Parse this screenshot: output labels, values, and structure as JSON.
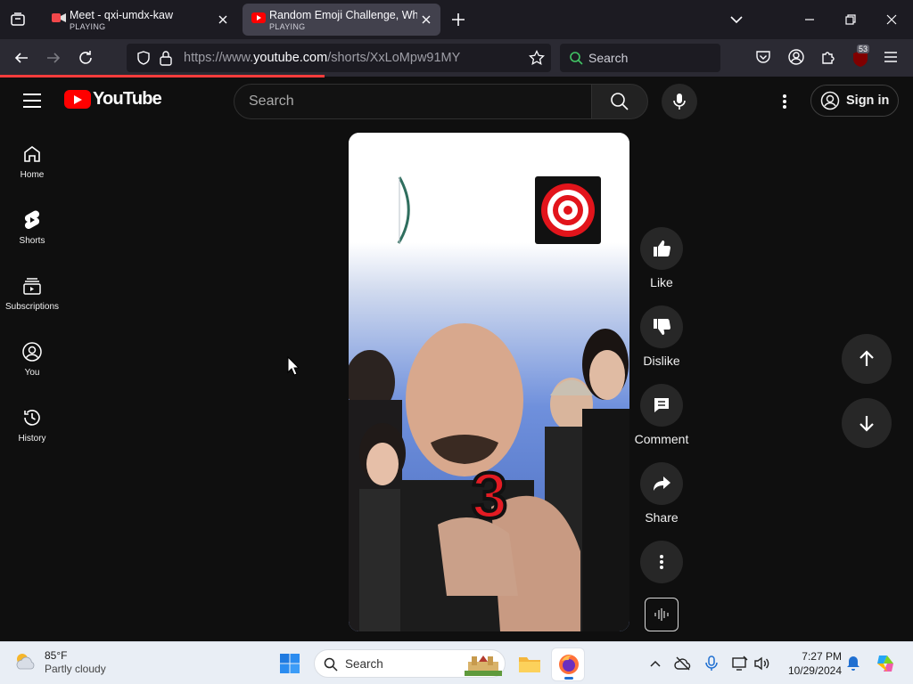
{
  "browser": {
    "tabs": [
      {
        "title": "Meet - qxi-umdx-kaw",
        "status": "PLAYING"
      },
      {
        "title": "Random Emoji Challenge, Who",
        "status": "PLAYING"
      }
    ],
    "url_prefix": "https://www.",
    "url_host": "youtube.com",
    "url_path": "/shorts/XxLoMpw91MY",
    "search_placeholder": "Search",
    "extension_badge": "53",
    "accent_color": "#ff3c3c"
  },
  "youtube": {
    "logo_text": "YouTube",
    "search_placeholder": "Search",
    "sign_in_label": "Sign in",
    "sidebar": [
      {
        "label": "Home"
      },
      {
        "label": "Shorts"
      },
      {
        "label": "Subscriptions"
      },
      {
        "label": "You"
      },
      {
        "label": "History"
      }
    ],
    "actions": {
      "like": "Like",
      "dislike": "Dislike",
      "comment": "Comment",
      "share": "Share"
    },
    "video_overlay_number": "3",
    "brand_color": "#ff0000"
  },
  "taskbar": {
    "temperature": "85°F",
    "condition": "Partly cloudy",
    "search_placeholder": "Search",
    "time": "7:27 PM",
    "date": "10/29/2024"
  }
}
